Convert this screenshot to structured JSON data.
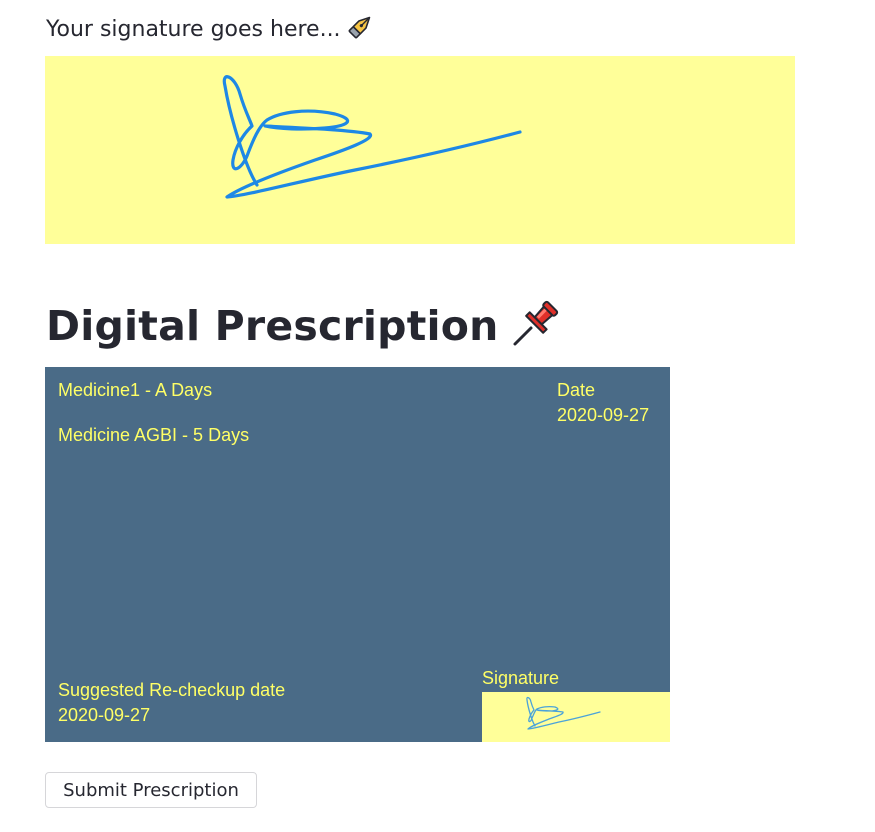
{
  "signature_pad": {
    "label": "Your signature goes here...",
    "label_icon": "fountain-pen-icon",
    "background_color": "#ffff99",
    "stroke_color": "#1e88e5"
  },
  "prescription": {
    "title": "Digital Prescription",
    "title_icon": "pushpin-icon",
    "card_background": "#4a6b87",
    "text_color": "#ffff66",
    "medicines": [
      "Medicine1 - A Days",
      "Medicine AGBI - 5 Days"
    ],
    "date_label": "Date",
    "date_value": "2020-09-27",
    "recheckup_label": "Suggested Re-checkup date",
    "recheckup_value": "2020-09-27",
    "signature_label": "Signature"
  },
  "actions": {
    "submit_label": "Submit Prescription"
  }
}
